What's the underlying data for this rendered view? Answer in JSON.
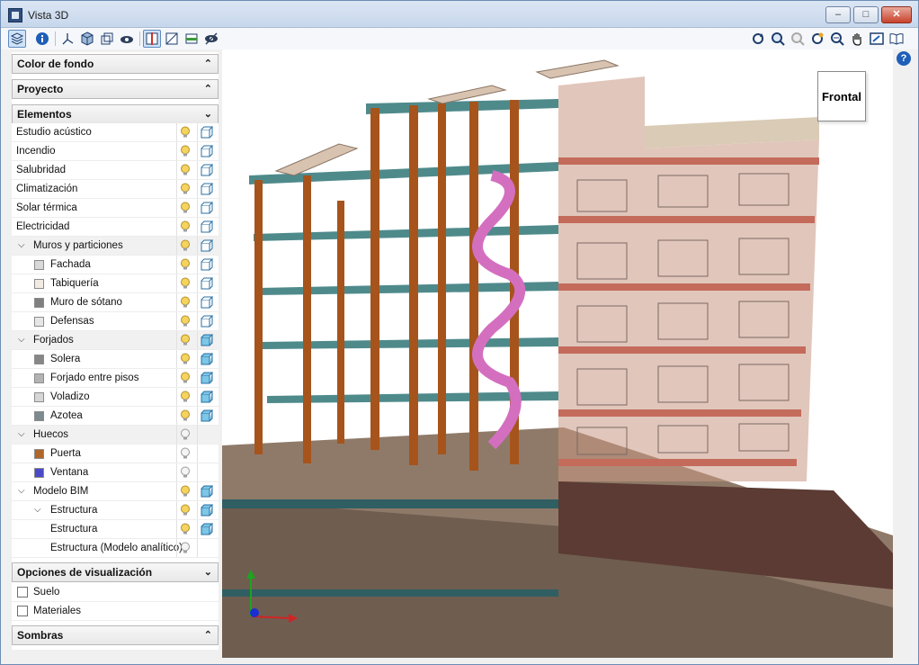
{
  "window": {
    "title": "Vista 3D"
  },
  "sections": {
    "color_fondo": "Color de fondo",
    "proyecto": "Proyecto",
    "elementos": "Elementos",
    "opciones": "Opciones de visualización",
    "sombras": "Sombras"
  },
  "elements": [
    {
      "label": "Estudio acústico",
      "level": 0,
      "swatch": null,
      "bulb": "on",
      "cube": "outline",
      "group": false,
      "expand": false
    },
    {
      "label": "Incendio",
      "level": 0,
      "swatch": null,
      "bulb": "on",
      "cube": "outline",
      "group": false,
      "expand": false
    },
    {
      "label": "Salubridad",
      "level": 0,
      "swatch": null,
      "bulb": "on",
      "cube": "outline",
      "group": false,
      "expand": false
    },
    {
      "label": "Climatización",
      "level": 0,
      "swatch": null,
      "bulb": "on",
      "cube": "outline",
      "group": false,
      "expand": false
    },
    {
      "label": "Solar térmica",
      "level": 0,
      "swatch": null,
      "bulb": "on",
      "cube": "outline",
      "group": false,
      "expand": false
    },
    {
      "label": "Electricidad",
      "level": 0,
      "swatch": null,
      "bulb": "on",
      "cube": "outline",
      "group": false,
      "expand": false
    },
    {
      "label": "Muros y particiones",
      "level": 0,
      "swatch": null,
      "bulb": "on",
      "cube": "outline",
      "group": true,
      "expand": true
    },
    {
      "label": "Fachada",
      "level": 1,
      "swatch": "#d9d9d9",
      "bulb": "on",
      "cube": "outline",
      "group": false,
      "expand": false
    },
    {
      "label": "Tabiquería",
      "level": 1,
      "swatch": "#f2ebe4",
      "bulb": "on",
      "cube": "outline",
      "group": false,
      "expand": false
    },
    {
      "label": "Muro de sótano",
      "level": 1,
      "swatch": "#808080",
      "bulb": "on",
      "cube": "outline",
      "group": false,
      "expand": false
    },
    {
      "label": "Defensas",
      "level": 1,
      "swatch": "#e6e6e6",
      "bulb": "on",
      "cube": "outline",
      "group": false,
      "expand": false
    },
    {
      "label": "Forjados",
      "level": 0,
      "swatch": null,
      "bulb": "on",
      "cube": "solid",
      "group": true,
      "expand": true
    },
    {
      "label": "Solera",
      "level": 1,
      "swatch": "#878787",
      "bulb": "on",
      "cube": "solid",
      "group": false,
      "expand": false
    },
    {
      "label": "Forjado entre pisos",
      "level": 1,
      "swatch": "#b3b3b3",
      "bulb": "on",
      "cube": "solid",
      "group": false,
      "expand": false
    },
    {
      "label": "Voladizo",
      "level": 1,
      "swatch": "#d6d6d6",
      "bulb": "on",
      "cube": "solid",
      "group": false,
      "expand": false
    },
    {
      "label": "Azotea",
      "level": 1,
      "swatch": "#7d8a90",
      "bulb": "on",
      "cube": "solid",
      "group": false,
      "expand": false
    },
    {
      "label": "Huecos",
      "level": 0,
      "swatch": null,
      "bulb": "off",
      "cube": "none",
      "group": true,
      "expand": true
    },
    {
      "label": "Puerta",
      "level": 1,
      "swatch": "#b0672b",
      "bulb": "off",
      "cube": "none",
      "group": false,
      "expand": false
    },
    {
      "label": "Ventana",
      "level": 1,
      "swatch": "#4a4ac8",
      "bulb": "off",
      "cube": "none",
      "group": false,
      "expand": false
    },
    {
      "label": "Modelo BIM",
      "level": 0,
      "swatch": null,
      "bulb": "on",
      "cube": "solid",
      "group": false,
      "expand": true
    },
    {
      "label": "Estructura",
      "level": 1,
      "swatch": null,
      "bulb": "on",
      "cube": "solid",
      "group": false,
      "expand": true
    },
    {
      "label": "Estructura",
      "level": 2,
      "swatch": null,
      "bulb": "on",
      "cube": "solid",
      "group": false,
      "expand": false
    },
    {
      "label": "Estructura (Modelo analítico)",
      "level": 2,
      "swatch": null,
      "bulb": "off",
      "cube": "none",
      "group": false,
      "expand": false
    }
  ],
  "options": [
    {
      "label": "Suelo",
      "checked": false
    },
    {
      "label": "Materiales",
      "checked": false
    }
  ],
  "viewcube": {
    "label": "Frontal"
  },
  "toolbar_left": [
    "layers-icon",
    "info-icon",
    "axes-icon",
    "shaded-cube-icon",
    "wireframe-cube-icon",
    "eye-cloud-icon",
    "section-plane-icon",
    "clip-plane-icon",
    "floor-plane-icon",
    "hide-eye-icon"
  ],
  "toolbar_right": [
    "rotate-icon",
    "zoom-extents-icon",
    "zoom-disabled-icon",
    "orbit-icon",
    "zoom-window-icon",
    "pan-hand-icon",
    "fit-window-icon",
    "book-icon"
  ],
  "colors": {
    "accent": "#2f6fbf",
    "structure_column": "#a6541c",
    "slab": "#4f8a8b",
    "ramp": "#d46fc0",
    "facade": "#c99783"
  }
}
